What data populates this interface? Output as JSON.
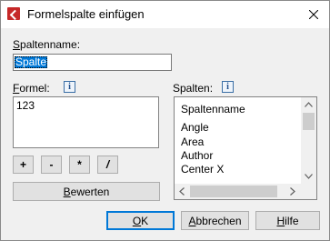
{
  "window": {
    "title": "Formelspalte einfügen",
    "close_glyph": "✕"
  },
  "column_name": {
    "label_ul": "S",
    "label_rest": "paltenname:",
    "value": "Spalte"
  },
  "formula": {
    "label_ul": "F",
    "label_rest": "ormel:",
    "value": "123",
    "info_glyph": "i"
  },
  "columns": {
    "label": "Spalten:",
    "info_glyph": "i",
    "items": [
      "Spaltenname",
      "Angle",
      "Area",
      "Author",
      "Center X"
    ]
  },
  "operators": {
    "plus": "+",
    "minus": "-",
    "multiply": "*",
    "divide": "/"
  },
  "evaluate": {
    "ul": "B",
    "rest": "ewerten"
  },
  "footer": {
    "ok_ul": "O",
    "ok_rest": "K",
    "cancel_ul": "A",
    "cancel_rest": "bbrechen",
    "help_ul": "H",
    "help_rest": "ilfe"
  }
}
